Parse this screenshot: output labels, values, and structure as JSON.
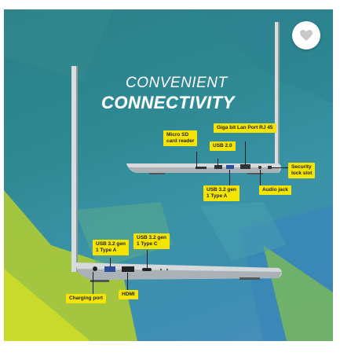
{
  "headline": {
    "line1": "CONVENIENT",
    "line2": "CONNECTIVITY"
  },
  "callouts": {
    "micro_sd": [
      "Micro SD",
      "card reader"
    ],
    "usb20": "USB 2.0",
    "gigabit": "Giga bit Lan Port RJ 45",
    "usb32_a_top": [
      "USB 3.2 gen",
      "1 Type A"
    ],
    "audio_jack": "Audio jack",
    "security_slot": [
      "Security",
      "lock slot"
    ],
    "usb32_a_bottom": [
      "USB 3.2 gen",
      "1 Type A"
    ],
    "usb32_c": [
      "USB 3.2 gen",
      "1 Type C"
    ],
    "hdmi": "HDMI",
    "charging_port": "Charging port"
  },
  "colors": {
    "tag_background": "#f4e400",
    "backdrop_teal": "#2f8a94",
    "backdrop_lime": "#b9d232"
  },
  "icons": {
    "favorite": "heart-icon"
  }
}
